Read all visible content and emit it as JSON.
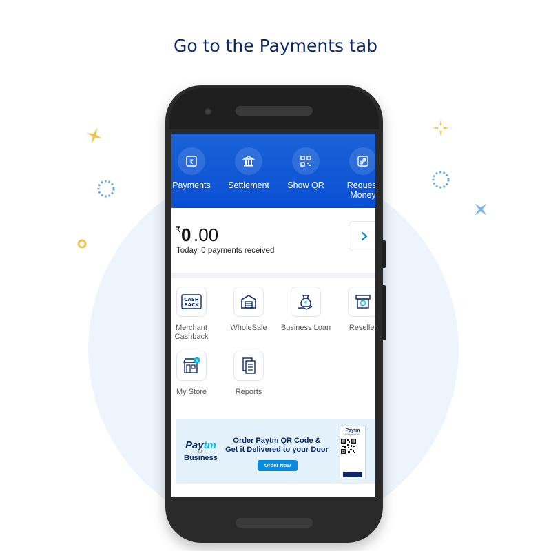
{
  "headline": "Go to the Payments tab",
  "colors": {
    "brand_blue": "#0a4fd4",
    "navy": "#0b2a66",
    "accent_cyan": "#00b9f1",
    "sparkle_yellow": "#f5c24a",
    "sparkle_blue": "#5ea8e6"
  },
  "top_actions": [
    {
      "label": "Payments",
      "icon": "rupee-icon"
    },
    {
      "label": "Settlement",
      "icon": "bank-icon"
    },
    {
      "label": "Show QR",
      "icon": "qr-icon"
    },
    {
      "label": "Request Money",
      "label_line1": "Request",
      "label_line2": "Money",
      "icon": "link-icon"
    }
  ],
  "balance": {
    "currency_symbol": "₹",
    "amount_integer": "0",
    "amount_decimal": ".00",
    "today_text": "Today, 0 payments received"
  },
  "services": [
    {
      "label": "Merchant Cashback",
      "line1": "Merchant",
      "line2": "Cashback",
      "icon": "cashback-icon",
      "icon_text": "CASH BACK"
    },
    {
      "label": "WholeSale",
      "icon": "warehouse-icon"
    },
    {
      "label": "Business Loan",
      "icon": "money-bag-icon"
    },
    {
      "label": "Reseller",
      "icon": "shop-icon"
    },
    {
      "label": "My Store",
      "icon": "store-icon"
    },
    {
      "label": "Reports",
      "icon": "reports-icon"
    }
  ],
  "banner": {
    "logo_paytm_a": "Pay",
    "logo_paytm_b": "tm",
    "logo_for": "for",
    "logo_business": "Business",
    "headline_line1": "Order Paytm QR Code &",
    "headline_line2": "Get it Delivered to your Door",
    "cta": "Order Now",
    "standee_logo": "Paytm",
    "standee_sub": "Accepted Here"
  }
}
